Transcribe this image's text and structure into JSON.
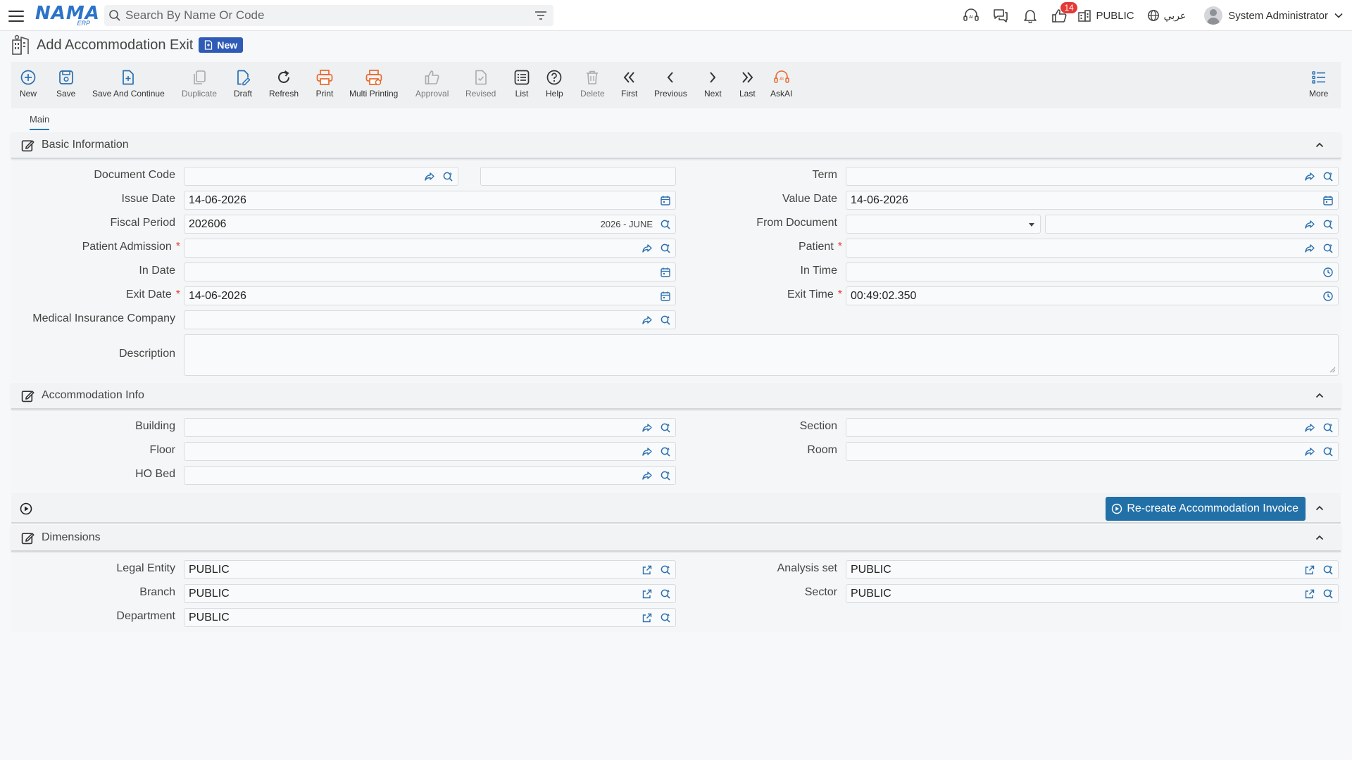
{
  "app": {
    "logo_text": "NAMA",
    "logo_sub": "ERP",
    "search_placeholder": "Search By Name Or Code",
    "badge_count": "14",
    "entity": "PUBLIC",
    "language": "عربي",
    "user": "System Administrator"
  },
  "page": {
    "title": "Add Accommodation Exit",
    "status_badge": "New"
  },
  "toolbar": {
    "new": "New",
    "save": "Save",
    "save_continue": "Save And Continue",
    "duplicate": "Duplicate",
    "draft": "Draft",
    "refresh": "Refresh",
    "print": "Print",
    "multi_printing": "Multi Printing",
    "approval": "Approval",
    "revised": "Revised",
    "list": "List",
    "help": "Help",
    "delete": "Delete",
    "first": "First",
    "previous": "Previous",
    "next": "Next",
    "last": "Last",
    "askai": "AskAI",
    "more": "More"
  },
  "tabs": {
    "main": "Main"
  },
  "basic": {
    "title": "Basic Information",
    "document_code": {
      "label": "Document Code",
      "value": "",
      "value2": ""
    },
    "term": {
      "label": "Term",
      "value": ""
    },
    "issue_date": {
      "label": "Issue Date",
      "value": "14-06-2026"
    },
    "value_date": {
      "label": "Value Date",
      "value": "14-06-2026"
    },
    "fiscal_period": {
      "label": "Fiscal Period",
      "value": "202606",
      "extra": "2026 - JUNE"
    },
    "from_document": {
      "label": "From Document",
      "value": "",
      "value2": ""
    },
    "patient_admission": {
      "label": "Patient Admission",
      "value": ""
    },
    "patient": {
      "label": "Patient",
      "value": ""
    },
    "in_date": {
      "label": "In Date",
      "value": ""
    },
    "in_time": {
      "label": "In Time",
      "value": ""
    },
    "exit_date": {
      "label": "Exit Date",
      "value": "14-06-2026"
    },
    "exit_time": {
      "label": "Exit Time",
      "value": "00:49:02.350"
    },
    "medical_insurance": {
      "label": "Medical Insurance Company",
      "value": ""
    },
    "description": {
      "label": "Description",
      "value": ""
    },
    "required_mark": "*"
  },
  "accommodation": {
    "title": "Accommodation Info",
    "building": {
      "label": "Building",
      "value": ""
    },
    "section": {
      "label": "Section",
      "value": ""
    },
    "floor": {
      "label": "Floor",
      "value": ""
    },
    "room": {
      "label": "Room",
      "value": ""
    },
    "ho_bed": {
      "label": "HO Bed",
      "value": ""
    }
  },
  "actions": {
    "recreate_invoice": "Re-create Accommodation Invoice"
  },
  "dimensions": {
    "title": "Dimensions",
    "legal_entity": {
      "label": "Legal Entity",
      "value": "PUBLIC"
    },
    "analysis_set": {
      "label": "Analysis set",
      "value": "PUBLIC"
    },
    "branch": {
      "label": "Branch",
      "value": "PUBLIC"
    },
    "sector": {
      "label": "Sector",
      "value": "PUBLIC"
    },
    "department": {
      "label": "Department",
      "value": "PUBLIC"
    }
  },
  "colors": {
    "accent": "#2270a8",
    "badge": "#2f5bb7",
    "required": "#e53935",
    "print": "#e8692c"
  }
}
